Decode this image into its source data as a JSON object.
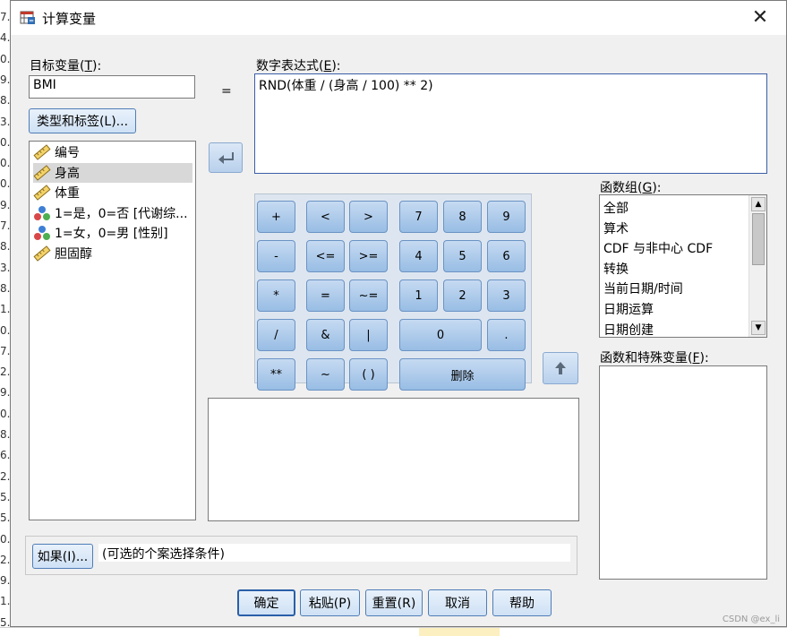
{
  "window": {
    "title": "计算变量",
    "close_label": "✕"
  },
  "left_strip": [
    "7.",
    "4.",
    "0.",
    "9.",
    "8.",
    "3.",
    "0.",
    "0.",
    "0.",
    "9.",
    "7.",
    "8.",
    "3.",
    "8.",
    "1.",
    "0.",
    "7.",
    "2.",
    "9.",
    "0.",
    "8.",
    "6.",
    "2.",
    "5.",
    "5.",
    "0.",
    "2.",
    "9.",
    "1.",
    "5."
  ],
  "target": {
    "label": "目标变量(",
    "label_key": "T",
    "label_end": "):",
    "value": "BMI"
  },
  "equals": "=",
  "type_label_button": "类型和标签(L)...",
  "variables": [
    {
      "name": "编号",
      "icon": "ruler-icon",
      "selected": false
    },
    {
      "name": "身高",
      "icon": "ruler-icon",
      "selected": true
    },
    {
      "name": "体重",
      "icon": "ruler-icon",
      "selected": false
    },
    {
      "name": "1=是，0=否 [代谢综...",
      "icon": "nominal-icon",
      "selected": false
    },
    {
      "name": "1=女，0=男 [性别]",
      "icon": "nominal-icon",
      "selected": false
    },
    {
      "name": "胆固醇",
      "icon": "ruler-icon",
      "selected": false
    }
  ],
  "expression": {
    "label": "数字表达式(",
    "label_key": "E",
    "label_end": "):",
    "value": "RND(体重 / (身高 / 100) ** 2)"
  },
  "keypad": {
    "ops": [
      "+",
      "<",
      ">",
      "-",
      "<=",
      ">=",
      "*",
      "=",
      "~=",
      "/",
      "&",
      "|",
      "**",
      "~",
      "( )"
    ],
    "digits": [
      "7",
      "8",
      "9",
      "4",
      "5",
      "6",
      "1",
      "2",
      "3"
    ],
    "zero": "0",
    "dot": ".",
    "delete": "删除"
  },
  "function_group": {
    "label": "函数组(",
    "label_key": "G",
    "label_end": "):",
    "items": [
      "全部",
      "算术",
      "CDF 与非中心 CDF",
      "转换",
      "当前日期/时间",
      "日期运算",
      "日期创建"
    ]
  },
  "functions_special": {
    "label": "函数和特殊变量(",
    "label_key": "F",
    "label_end": "):"
  },
  "if_button": "如果(I)...",
  "if_condition": "(可选的个案选择条件)",
  "footer": {
    "ok": "确定",
    "paste": "粘贴(P)",
    "reset": "重置(R)",
    "cancel": "取消",
    "help": "帮助"
  },
  "watermark": "CSDN @ex_li"
}
